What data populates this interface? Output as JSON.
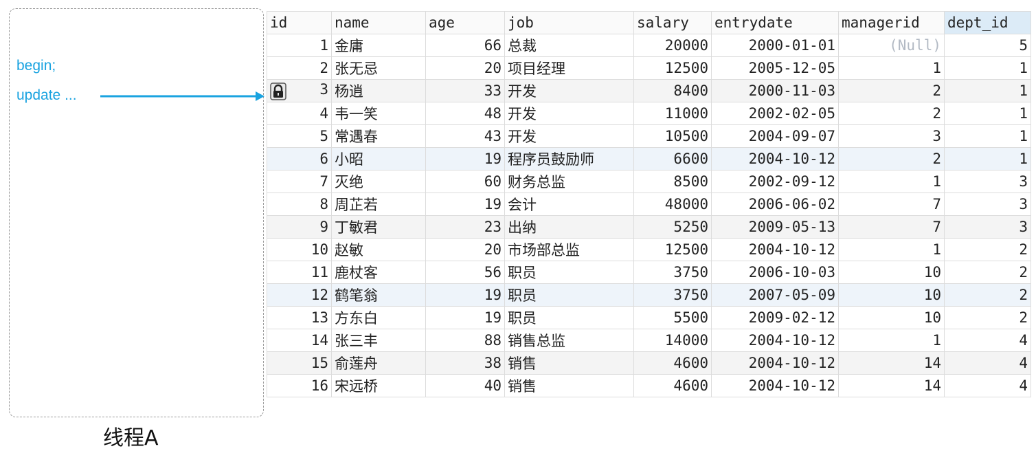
{
  "thread": {
    "code_lines": [
      "begin;",
      "update ..."
    ],
    "label": "线程A"
  },
  "table": {
    "columns": [
      "id",
      "name",
      "age",
      "job",
      "salary",
      "entrydate",
      "managerid",
      "dept_id"
    ],
    "sorted_column": "dept_id",
    "locked_row_id": "3",
    "rows": [
      [
        "1",
        "金庸",
        "66",
        "总裁",
        "20000",
        "2000-01-01",
        "(Null)",
        "5"
      ],
      [
        "2",
        "张无忌",
        "20",
        "项目经理",
        "12500",
        "2005-12-05",
        "1",
        "1"
      ],
      [
        "3",
        "杨逍",
        "33",
        "开发",
        "8400",
        "2000-11-03",
        "2",
        "1"
      ],
      [
        "4",
        "韦一笑",
        "48",
        "开发",
        "11000",
        "2002-02-05",
        "2",
        "1"
      ],
      [
        "5",
        "常遇春",
        "43",
        "开发",
        "10500",
        "2004-09-07",
        "3",
        "1"
      ],
      [
        "6",
        "小昭",
        "19",
        "程序员鼓励师",
        "6600",
        "2004-10-12",
        "2",
        "1"
      ],
      [
        "7",
        "灭绝",
        "60",
        "财务总监",
        "8500",
        "2002-09-12",
        "1",
        "3"
      ],
      [
        "8",
        "周芷若",
        "19",
        "会计",
        "48000",
        "2006-06-02",
        "7",
        "3"
      ],
      [
        "9",
        "丁敏君",
        "23",
        "出纳",
        "5250",
        "2009-05-13",
        "7",
        "3"
      ],
      [
        "10",
        "赵敏",
        "20",
        "市场部总监",
        "12500",
        "2004-10-12",
        "1",
        "2"
      ],
      [
        "11",
        "鹿杖客",
        "56",
        "职员",
        "3750",
        "2006-10-03",
        "10",
        "2"
      ],
      [
        "12",
        "鹤笔翁",
        "19",
        "职员",
        "3750",
        "2007-05-09",
        "10",
        "2"
      ],
      [
        "13",
        "方东白",
        "19",
        "职员",
        "5500",
        "2009-02-12",
        "10",
        "2"
      ],
      [
        "14",
        "张三丰",
        "88",
        "销售总监",
        "14000",
        "2004-10-12",
        "1",
        "4"
      ],
      [
        "15",
        "俞莲舟",
        "38",
        "销售",
        "4600",
        "2004-10-12",
        "14",
        "4"
      ],
      [
        "16",
        "宋远桥",
        "40",
        "销售",
        "4600",
        "2004-10-12",
        "14",
        "4"
      ]
    ]
  },
  "colors": {
    "code_text": "#1aa3e0",
    "arrow": "#1aa3e0",
    "null_text": "#b3bac4",
    "sorted_header": "#dcebf7"
  },
  "icons": {
    "lock": "lock-icon"
  }
}
